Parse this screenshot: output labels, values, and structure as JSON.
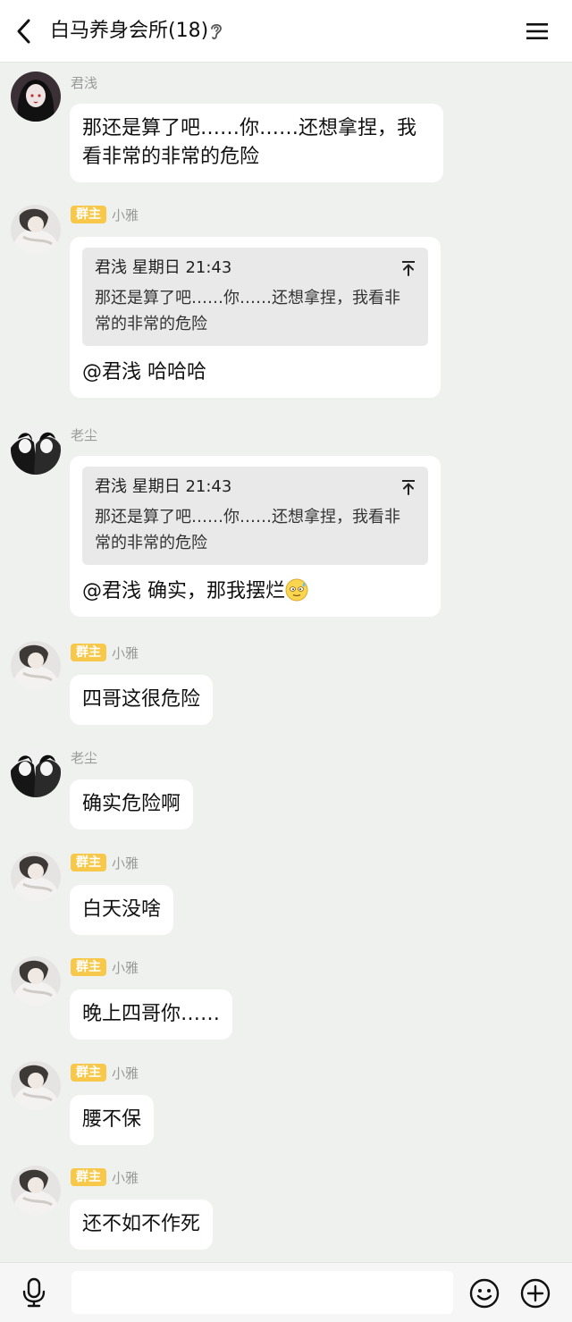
{
  "header": {
    "title": "白马养身会所(18)"
  },
  "messages": [
    {
      "sender": "君浅",
      "badge": "",
      "text": "那还是算了吧……你……还想拿捏，我看非常的非常的危险"
    },
    {
      "sender": "小雅",
      "badge": "群主",
      "quote": {
        "head": "君浅 星期日 21:43",
        "body": "那还是算了吧……你……还想拿捏，我看非常的非常的危险"
      },
      "text": "@君浅 哈哈哈"
    },
    {
      "sender": "老尘",
      "badge": "",
      "quote": {
        "head": "君浅 星期日 21:43",
        "body": "那还是算了吧……你……还想拿捏，我看非常的非常的危险"
      },
      "text": "@君浅 确实，那我摆烂"
    },
    {
      "sender": "小雅",
      "badge": "群主",
      "text": "四哥这很危险"
    },
    {
      "sender": "老尘",
      "badge": "",
      "text": "确实危险啊"
    },
    {
      "sender": "小雅",
      "badge": "群主",
      "text": "白天没啥"
    },
    {
      "sender": "小雅",
      "badge": "群主",
      "text": "晚上四哥你……"
    },
    {
      "sender": "小雅",
      "badge": "群主",
      "text": "腰不保"
    },
    {
      "sender": "小雅",
      "badge": "群主",
      "text": "还不如不作死"
    }
  ],
  "icons": {
    "back": "chevron-left-icon",
    "ear": "ear-icon",
    "menu": "hamburger-menu-icon",
    "mic": "microphone-icon",
    "emoji": "smiley-icon",
    "plus": "plus-circle-icon",
    "jump": "jump-to-top-icon"
  },
  "colors": {
    "background": "#eef1ee",
    "bubble": "#ffffff",
    "badge": "#f7c84a",
    "quote": "#e9e9e9"
  }
}
